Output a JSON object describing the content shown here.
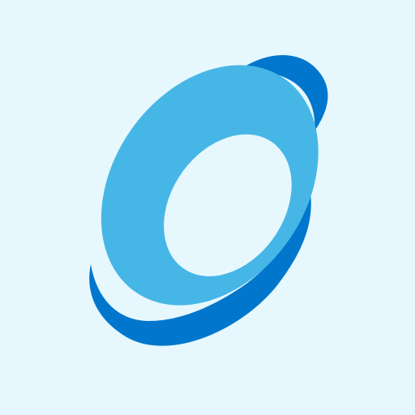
{
  "app_icon": {
    "icon": "blue-swirl-ring-icon",
    "colors": {
      "background": "#E6F8FD",
      "ring": "#46B6E6",
      "swoosh": "#0077CC",
      "hole": "#E6F8FD"
    }
  }
}
